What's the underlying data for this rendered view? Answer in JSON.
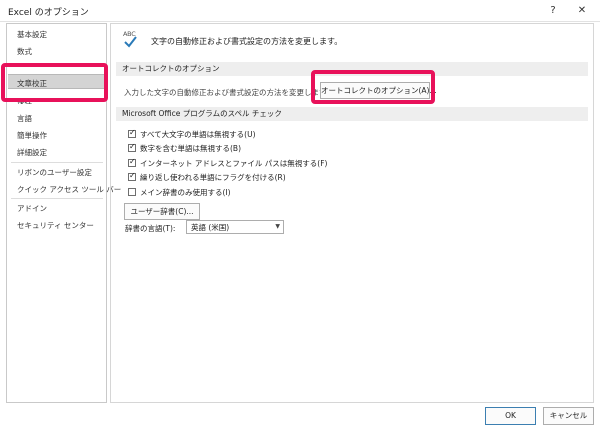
{
  "window": {
    "title": "Excel のオプション",
    "help": "?",
    "close": "✕"
  },
  "nav": {
    "items": [
      "基本設定",
      "数式",
      "文章校正",
      "保存",
      "言語",
      "簡単操作",
      "詳細設定",
      "リボンのユーザー設定",
      "クイック アクセス ツール バー",
      "アドイン",
      "セキュリティ センター"
    ],
    "selected": "文章校正"
  },
  "main": {
    "header": "文字の自動修正および書式設定の方法を変更します。",
    "icon_text": "ABC",
    "autocorrect": {
      "section": "オートコレクトのオプション",
      "description": "入力した文字の自動修正および書式設定の方法を変更します:",
      "button": "オートコレクトのオプション(A)..."
    },
    "spelling": {
      "section": "Microsoft Office プログラムのスペル チェック",
      "options": [
        {
          "label": "すべて大文字の単語は無視する(U)",
          "checked": true
        },
        {
          "label": "数字を含む単語は無視する(B)",
          "checked": true
        },
        {
          "label": "インターネット アドレスとファイル パスは無視する(F)",
          "checked": true
        },
        {
          "label": "繰り返し使われる単語にフラグを付ける(R)",
          "checked": true
        },
        {
          "label": "メイン辞書のみ使用する(I)",
          "checked": false
        }
      ],
      "dict_button": "ユーザー辞書(C)...",
      "lang_label": "辞書の言語(T):",
      "lang_value": "英語 (米国)"
    }
  },
  "buttons": {
    "ok": "OK",
    "cancel": "キャンセル"
  },
  "colors": {
    "highlight": "#e8115a",
    "selected_bg": "#d4d4d4",
    "section_bg": "#eeeeee",
    "check": "#222222"
  }
}
